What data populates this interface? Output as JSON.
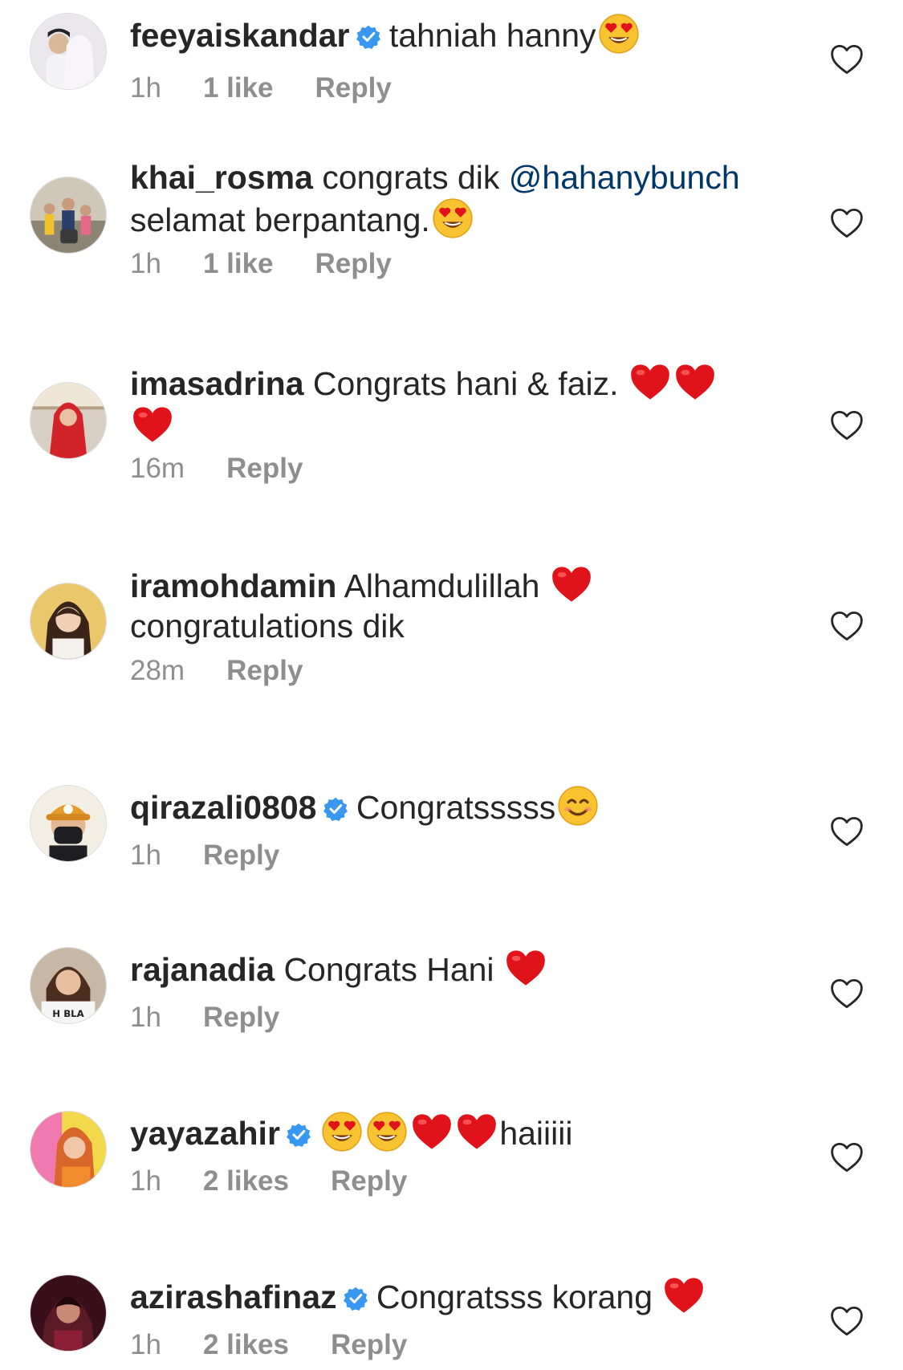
{
  "colors": {
    "text": "#262626",
    "muted": "#8e8e8e",
    "mention": "#00376b",
    "verified": "#3897f0",
    "heart": "#e0131a"
  },
  "comments": [
    {
      "username": "feeyaiskandar",
      "verified": true,
      "text1": "tahniah hanny",
      "time": "1h",
      "likes": "1 like",
      "reply": "Reply"
    },
    {
      "username": "khai_rosma",
      "verified": false,
      "text1": "congrats dik",
      "mention": "@hahanybunch",
      "text2": "selamat berpantang.",
      "time": "1h",
      "likes": "1 like",
      "reply": "Reply"
    },
    {
      "username": "imasadrina",
      "verified": false,
      "text1": "Congrats hani & faiz.",
      "time": "16m",
      "reply": "Reply"
    },
    {
      "username": "iramohdamin",
      "verified": false,
      "text1": "Alhamdulillah",
      "text2": "congratulations dik",
      "time": "28m",
      "reply": "Reply"
    },
    {
      "username": "qirazali0808",
      "verified": true,
      "text1": "Congratsssss",
      "time": "1h",
      "reply": "Reply"
    },
    {
      "username": "rajanadia",
      "verified": false,
      "text1": "Congrats Hani",
      "time": "1h",
      "reply": "Reply"
    },
    {
      "username": "yayazahir",
      "verified": true,
      "text1": "haiiiii",
      "time": "1h",
      "likes": "2 likes",
      "reply": "Reply"
    },
    {
      "username": "azirashafinaz",
      "verified": true,
      "text1": "Congratsss korang",
      "time": "1h",
      "likes": "2 likes",
      "reply": "Reply"
    }
  ],
  "icons": {
    "verified": "verified-badge-icon",
    "like": "heart-outline-icon",
    "emoji_love": "heart-eyes-emoji",
    "emoji_smile": "smiling-face-emoji",
    "emoji_heart": "red-heart-emoji"
  }
}
